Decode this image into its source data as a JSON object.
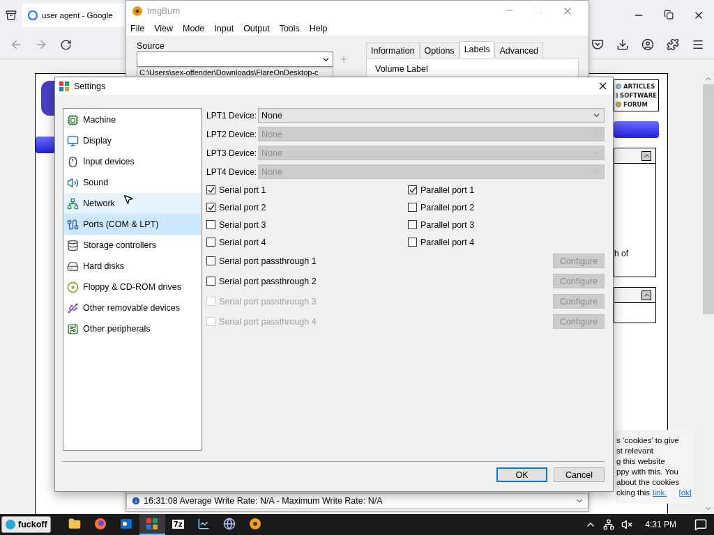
{
  "browser": {
    "tab_title": "user agent - Google",
    "site_links": [
      "ARTICLES",
      "SOFTWARE",
      "FORUM"
    ],
    "panel_text": "h of",
    "cookie_notice": {
      "lines": [
        "s ‘cookies’ to give",
        "st relevant",
        "g this website",
        "ppy with this. You",
        "about the cookies"
      ],
      "last_line": "cking this",
      "link": "link.",
      "dismiss": "[ok]"
    }
  },
  "imgburn": {
    "title": "ImgBurn",
    "menu": [
      "File",
      "View",
      "Mode",
      "Input",
      "Output",
      "Tools",
      "Help"
    ],
    "source_label": "Source",
    "source_path": "C:\\Users\\sex-offender\\Downloads\\FlareOnDesktop-c",
    "tabs": [
      {
        "label": "Information",
        "selected": false
      },
      {
        "label": "Options",
        "selected": false
      },
      {
        "label": "Labels",
        "selected": true
      },
      {
        "label": "Advanced",
        "selected": false
      }
    ],
    "volume_label": "Volume Label",
    "status": "16:31:08 Average Write Rate: N/A - Maximum Write Rate: N/A"
  },
  "settings": {
    "title": "Settings",
    "categories": [
      {
        "label": "Machine",
        "selected": false,
        "hovered": false
      },
      {
        "label": "Display",
        "selected": false,
        "hovered": false
      },
      {
        "label": "Input devices",
        "selected": false,
        "hovered": false
      },
      {
        "label": "Sound",
        "selected": false,
        "hovered": false
      },
      {
        "label": "Network",
        "selected": false,
        "hovered": true
      },
      {
        "label": "Ports (COM & LPT)",
        "selected": true,
        "hovered": false
      },
      {
        "label": "Storage controllers",
        "selected": false,
        "hovered": false
      },
      {
        "label": "Hard disks",
        "selected": false,
        "hovered": false
      },
      {
        "label": "Floppy & CD-ROM drives",
        "selected": false,
        "hovered": false
      },
      {
        "label": "Other removable devices",
        "selected": false,
        "hovered": false
      },
      {
        "label": "Other peripherals",
        "selected": false,
        "hovered": false
      }
    ],
    "lpt_devices": [
      {
        "label": "LPT1 Device:",
        "value": "None",
        "disabled": false
      },
      {
        "label": "LPT2 Device:",
        "value": "None",
        "disabled": true
      },
      {
        "label": "LPT3 Device:",
        "value": "None",
        "disabled": true
      },
      {
        "label": "LPT4 Device:",
        "value": "None",
        "disabled": true
      }
    ],
    "ports": [
      {
        "label": "Serial port 1",
        "checked": true
      },
      {
        "label": "Parallel port 1",
        "checked": true
      },
      {
        "label": "Serial port 2",
        "checked": true
      },
      {
        "label": "Parallel port 2",
        "checked": false
      },
      {
        "label": "Serial port 3",
        "checked": false
      },
      {
        "label": "Parallel port 3",
        "checked": false
      },
      {
        "label": "Serial port 4",
        "checked": false
      },
      {
        "label": "Parallel port 4",
        "checked": false
      }
    ],
    "passthrough": [
      {
        "label": "Serial port passthrough 1",
        "checked": false,
        "disabled": false,
        "button": "Configure"
      },
      {
        "label": "Serial port passthrough 2",
        "checked": false,
        "disabled": false,
        "button": "Configure"
      },
      {
        "label": "Serial port passthrough 3",
        "checked": false,
        "disabled": true,
        "button": "Configure"
      },
      {
        "label": "Serial port passthrough 4",
        "checked": false,
        "disabled": true,
        "button": "Configure"
      }
    ],
    "buttons": [
      {
        "label": "OK",
        "default": true
      },
      {
        "label": "Cancel",
        "default": false
      }
    ]
  },
  "taskbar": {
    "start_label": "fuckoff",
    "apps": [
      {
        "selected": false
      },
      {
        "selected": false
      },
      {
        "selected": false
      },
      {
        "selected": true
      },
      {
        "selected": false,
        "label": "7z"
      },
      {
        "selected": false
      },
      {
        "selected": false
      },
      {
        "selected": false
      }
    ],
    "clock": "4:31 PM"
  }
}
